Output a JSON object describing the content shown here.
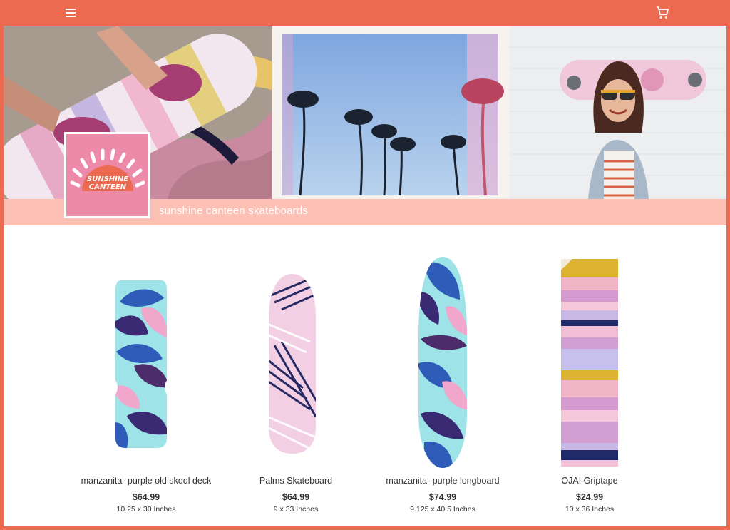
{
  "topbar": {
    "menu_icon": "hamburger-menu-icon",
    "cart_icon": "shopping-cart-icon"
  },
  "banner": {
    "store_name": "sunshine canteen skateboards",
    "logo_text": "SUNSHINE CANTEEN"
  },
  "products": [
    {
      "name": "manzanita- purple old skool deck",
      "price": "$64.99",
      "size": "10.25 x 30 Inches"
    },
    {
      "name": "Palms Skateboard",
      "price": "$64.99",
      "size": "9 x 33 Inches"
    },
    {
      "name": "manzanita- purple longboard",
      "price": "$74.99",
      "size": "9.125 x 40.5 Inches"
    },
    {
      "name": "OJAI Griptape",
      "price": "$24.99",
      "size": "10 x 36 Inches"
    }
  ],
  "colors": {
    "accent": "#ec6b50",
    "banner_strip": "#fdc0b4",
    "logo_bg": "#ee8aa9"
  }
}
